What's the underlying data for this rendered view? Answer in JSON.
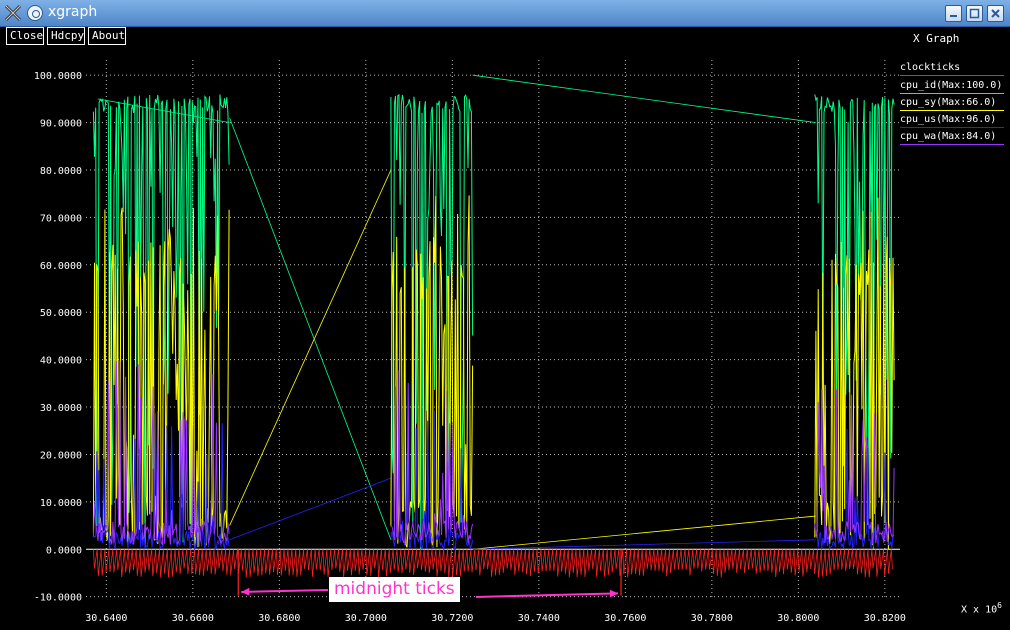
{
  "window": {
    "title": "xgraph"
  },
  "toolbar": {
    "close_label": "Close",
    "hdcpy_label": "Hdcpy",
    "about_label": "About"
  },
  "graph_title": "X Graph",
  "x_unit": "X x 10",
  "x_unit_exp": "6",
  "annotation": "midnight ticks",
  "legend": [
    {
      "label": "clockticks",
      "color": "#ff2020"
    },
    {
      "label": "cpu_id(Max:100.0)",
      "color": "#00ff88"
    },
    {
      "label": "cpu_sy(Max:66.0)",
      "color": "#ffff00"
    },
    {
      "label": "cpu_us(Max:96.0)",
      "color": "#2222ff"
    },
    {
      "label": "cpu_wa(Max:84.0)",
      "color": "#9933ff"
    }
  ],
  "chart_data": {
    "type": "line",
    "title": "X Graph",
    "xlabel": "X x 10^6",
    "ylabel": "",
    "grid": true,
    "legend": "right",
    "xlim": [
      30.6353,
      30.8235
    ],
    "ylim": [
      -10.7,
      103.2
    ],
    "xticks": [
      "30.6400",
      "30.6600",
      "30.6800",
      "30.7000",
      "30.7200",
      "30.7400",
      "30.7600",
      "30.7800",
      "30.8000",
      "30.8200"
    ],
    "yticks": [
      "-10.0000",
      "0.0000",
      "10.0000",
      "20.0000",
      "30.0000",
      "40.0000",
      "50.0000",
      "60.0000",
      "70.0000",
      "80.0000",
      "90.0000",
      "100.0000"
    ],
    "xtick_values": [
      30.64,
      30.66,
      30.68,
      30.7,
      30.72,
      30.74,
      30.76,
      30.78,
      30.8,
      30.82
    ],
    "ytick_values": [
      -10,
      0,
      10,
      20,
      30,
      40,
      50,
      60,
      70,
      80,
      90,
      100
    ],
    "series": [
      {
        "name": "clockticks",
        "color": "#ff2020",
        "midnight_ticks": [
          30.6705,
          30.759
        ]
      },
      {
        "name": "cpu_id(Max:100.0)",
        "color": "#00ff88",
        "max": 100.0,
        "bursts": [
          [
            30.637,
            30.6685
          ],
          [
            30.7058,
            30.7247
          ],
          [
            30.8038,
            30.8223
          ]
        ],
        "connectors": [
          [
            30.638,
            95,
            30.6685,
            90
          ],
          [
            30.6685,
            91,
            30.7058,
            2
          ],
          [
            30.7247,
            100,
            30.804,
            90
          ]
        ]
      },
      {
        "name": "cpu_sy(Max:66.0)",
        "color": "#ffff00",
        "max": 66.0,
        "connectors": [
          [
            30.6685,
            5,
            30.7058,
            80
          ],
          [
            30.7247,
            0,
            30.804,
            7
          ]
        ]
      },
      {
        "name": "cpu_us(Max:96.0)",
        "color": "#2222ff",
        "max": 96.0,
        "connectors": [
          [
            30.6685,
            2,
            30.7058,
            15
          ],
          [
            30.7247,
            0,
            30.804,
            2
          ]
        ]
      },
      {
        "name": "cpu_wa(Max:84.0)",
        "color": "#9933ff",
        "max": 84.0
      }
    ]
  }
}
